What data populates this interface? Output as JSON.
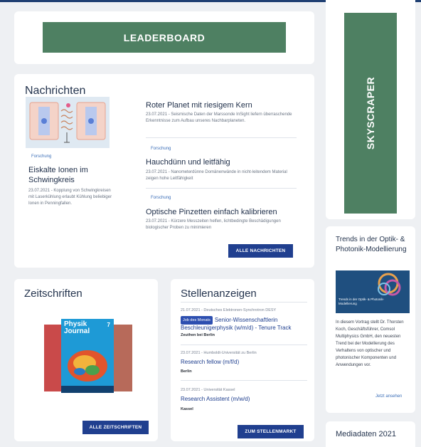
{
  "ads": {
    "leaderboard": "LEADERBOARD",
    "skyscraper": "SKYSCRAPER"
  },
  "news": {
    "heading": "Nachrichten",
    "featured": {
      "tag": "Forschung",
      "title": "Eiskalte Ionen im Schwingkreis",
      "meta": "23.07.2021 - Kopplung von Schwingkreisen mit Laserkühlung erlaubt Kühlung beliebiger Ionen in Penningfallen."
    },
    "items": [
      {
        "tag": "",
        "title": "Roter Planet mit riesigem Kern",
        "meta": "23.07.2021 - Seismische Daten der Marssonde InSight liefern überraschende Erkenntnisse zum Aufbau unseres Nachbarplaneten."
      },
      {
        "tag": "Forschung",
        "title": "Hauchdünn und leitfähig",
        "meta": "23.07.2021 - Nanometerdünne Domänenwände in nicht-leitendem Material zeigen hohe Leitfähigkeit"
      },
      {
        "tag": "Forschung",
        "title": "Optische Pinzetten einfach kalibrieren",
        "meta": "23.07.2021 - Kürzere Messzeiten helfen, lichtbedingte Beschädigungen biologischer Proben zu minimieren"
      }
    ],
    "all_button": "ALLE NACHRICHTEN"
  },
  "journals": {
    "heading": "Zeitschriften",
    "cover_title": "Physik Journal",
    "cover_issue": "7",
    "all_button": "ALLE ZEITSCHRIFTEN"
  },
  "jobs": {
    "heading": "Stellenanzeigen",
    "items": [
      {
        "company": "21.07.2021 - Deutsches Elektronen-Synchrotron DESY",
        "badge": "Job des Monats",
        "title": "Senior-Wissenschaftlerin Beschleunigerphysik (w/m/d) - Tenure Track",
        "location": "Zeuthen bei Berlin"
      },
      {
        "company": "23.07.2021 - Humboldt-Universität zu Berlin",
        "badge": "",
        "title": "Research fellow (m/f/d)",
        "location": "Berlin"
      },
      {
        "company": "23.07.2021 - Universität Kassel",
        "badge": "",
        "title": "Research Assistent (m/w/d)",
        "location": "Kassel"
      }
    ],
    "market_button": "ZUM STELLENMARKT"
  },
  "sidebar": {
    "trends_heading": "Trends in der Optik- & Photonik-Modellierung",
    "trends_image_caption": "Trends in der Optik- & Photonik-Modellierung",
    "trends_text": "In diesem Vortrag stellt Dr. Thorsten Koch, Geschäftsführer, Comsol Multiphysics GmbH, den neuesten Trend bei der Modellierung des Verhaltens von optischer und photonischer Komponenten und Anwendungen vor.",
    "trends_link": "Jetzt ansehen",
    "mediadaten_heading": "Mediadaten 2021"
  },
  "colors": {
    "accent_green": "#4e8062",
    "button_blue": "#203f8f"
  }
}
